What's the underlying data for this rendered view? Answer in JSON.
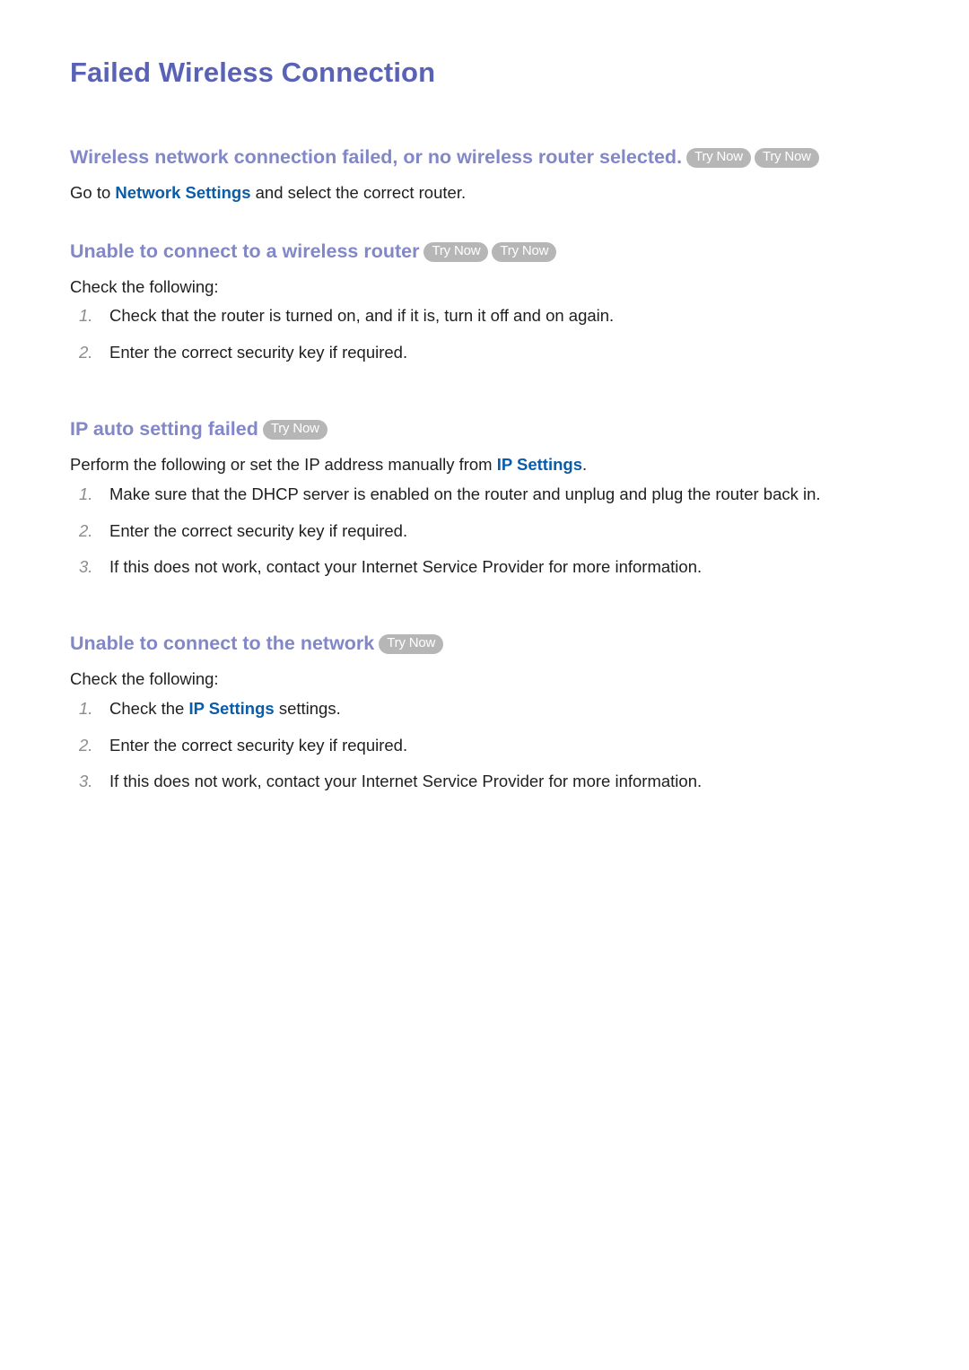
{
  "page": {
    "title": "Failed Wireless Connection"
  },
  "badges": {
    "try_now": "Try Now"
  },
  "sections": [
    {
      "id": "wireless-network-connection-failed",
      "heading": "Wireless network connection failed, or no wireless router selected.",
      "badge_count": 2,
      "intro_before": "Go to ",
      "intro_link": "Network Settings",
      "intro_after": " and select the correct router.",
      "steps": []
    },
    {
      "id": "unable-to-connect-to-a-wireless-router",
      "heading": "Unable to connect to a wireless router",
      "badge_count": 2,
      "intro_before": "Check the following:",
      "intro_link": "",
      "intro_after": "",
      "steps": [
        {
          "num": "1.",
          "text": "Check that the router is turned on, and if it is, turn it off and on again."
        },
        {
          "num": "2.",
          "text": "Enter the correct security key if required."
        }
      ]
    },
    {
      "id": "ip-auto-setting-failed",
      "heading": "IP auto setting failed",
      "badge_count": 1,
      "intro_before": "Perform the following or set the IP address manually from ",
      "intro_link": "IP Settings",
      "intro_after": ".",
      "steps": [
        {
          "num": "1.",
          "text": "Make sure that the DHCP server is enabled on the router and unplug and plug the router back in."
        },
        {
          "num": "2.",
          "text": "Enter the correct security key if required."
        },
        {
          "num": "3.",
          "text": "If this does not work, contact your Internet Service Provider for more information."
        }
      ]
    },
    {
      "id": "unable-to-connect-to-the-network",
      "heading": "Unable to connect to the network",
      "badge_count": 1,
      "intro_before": "Check the following:",
      "intro_link": "",
      "intro_after": "",
      "steps": [
        {
          "num": "1.",
          "text_before": "Check the ",
          "link": "IP Settings",
          "text_after": " settings."
        },
        {
          "num": "2.",
          "text": "Enter the correct security key if required."
        },
        {
          "num": "3.",
          "text": "If this does not work, contact your Internet Service Provider for more information."
        }
      ]
    }
  ],
  "colors": {
    "page_title": "#5a62b5",
    "section_heading": "#8287c8",
    "link": "#0b5ca8",
    "badge_bg": "#b6b6b6",
    "badge_text": "#ffffff",
    "body_text": "#1f1f1f",
    "list_number": "#8c8c8c",
    "background": "#ffffff"
  }
}
